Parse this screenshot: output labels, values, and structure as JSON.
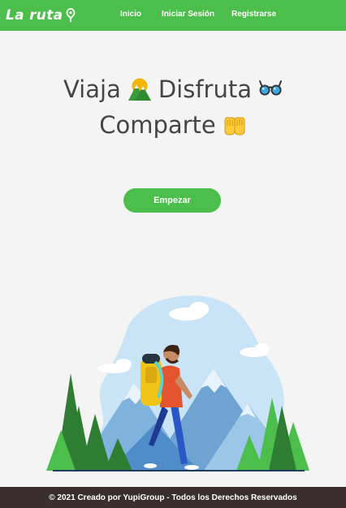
{
  "brand": {
    "name": "La ruta",
    "icon": "map-pin-icon"
  },
  "nav": [
    {
      "label": "Inicio"
    },
    {
      "label": "Iniciar Sesión"
    },
    {
      "label": "Registrarse"
    }
  ],
  "hero": {
    "word1": "Viaja",
    "word2": "Disfruta",
    "word3": "Comparte",
    "icons": [
      "mountain-emoji-icon",
      "sunglasses-emoji-icon",
      "clapping-hands-emoji-icon"
    ]
  },
  "cta": {
    "label": "Empezar"
  },
  "footer": {
    "text": "© 2021 Creado por YupiGroup - Todos los Derechos Reservados"
  },
  "colors": {
    "primary": "#4cbe4c",
    "footer_bg": "#3a2f2f",
    "background": "#f4f4f4",
    "text": "#454545"
  }
}
